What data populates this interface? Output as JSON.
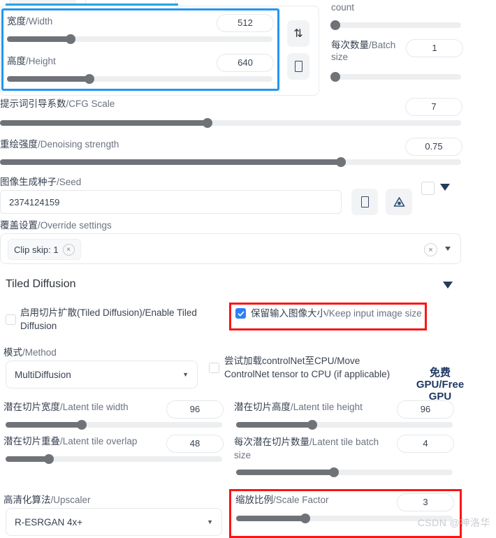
{
  "size_panel": {
    "width": {
      "label_cn": "宽度",
      "label_en": "Width",
      "value": "512",
      "slider_pct": 24
    },
    "height": {
      "label_cn": "高度",
      "label_en": "Height",
      "value": "640",
      "slider_pct": 31
    },
    "swap_icon": "swap-vertical-icon",
    "ratio_icon": "aspect-ratio-icon"
  },
  "batch": {
    "count_label_tail": "count",
    "count_slider_pct": 3,
    "size_label_cn": "每次数量",
    "size_label_en": "Batch size",
    "size_value": "1",
    "size_slider_pct": 3
  },
  "cfg": {
    "label_cn": "提示词引导系数",
    "label_en": "CFG Scale",
    "value": "7",
    "slider_pct": 45
  },
  "denoise": {
    "label_cn": "重绘强度",
    "label_en": "Denoising strength",
    "value": "0.75",
    "slider_pct": 74
  },
  "seed": {
    "label_cn": "图像生成种子",
    "label_en": "Seed",
    "value": "2374124159",
    "dice_icon": "dice-icon",
    "recycle_icon": "recycle-icon",
    "extra_checkbox": "seed-extra-checkbox",
    "expand_icon": "chevron-down-icon"
  },
  "override": {
    "label_cn": "覆盖设置",
    "label_en": "Override settings",
    "tags": [
      {
        "text": "Clip skip: 1",
        "remove": "×"
      }
    ],
    "clear": "×",
    "caret": "▾"
  },
  "tiled_diffusion": {
    "title": "Tiled Diffusion",
    "collapse_icon": "triangle-down-icon",
    "enable": {
      "label": "启用切片扩散(Tiled Diffusion)/Enable Tiled Diffusion",
      "checked": false
    },
    "keep_input_size": {
      "label_cn": "保留输入图像大小",
      "label_en": "Keep input image size",
      "checked": true,
      "highlight_color": "#fa1414"
    },
    "method": {
      "label_cn": "模式",
      "label_en": "Method",
      "value": "MultiDiffusion",
      "caret": "▾"
    },
    "move_controlnet": {
      "line1": "尝试加载controlNet至CPU/Move",
      "line2": "ControlNet tensor to CPU (if applicable)",
      "checked": false
    },
    "free_gpu": {
      "line1": "免费",
      "line2": "GPU/Free",
      "line3": "GPU"
    },
    "latent_tile_width": {
      "label_cn": "潜在切片宽度",
      "label_en": "Latent tile width",
      "value": "96",
      "slider_pct": 35
    },
    "latent_tile_height": {
      "label_cn": "潜在切片高度",
      "label_en": "Latent tile height",
      "value": "96",
      "slider_pct": 35
    },
    "latent_tile_overlap": {
      "label_cn": "潜在切片重叠",
      "label_en": "Latent tile overlap",
      "value": "48",
      "slider_pct": 20
    },
    "latent_tile_batch_size": {
      "label_cn": "每次潜在切片数量",
      "label_en": "Latent tile batch size",
      "value": "4",
      "slider_pct": 45
    },
    "upscaler": {
      "label_cn": "高清化算法",
      "label_en": "Upscaler",
      "value": "R-ESRGAN 4x+",
      "caret": "▾"
    },
    "scale_factor": {
      "label_cn": "缩放比例",
      "label_en": "Scale Factor",
      "value": "3",
      "slider_pct": 32,
      "highlight_color": "#fa1414"
    }
  },
  "watermark": "CSDN @神洛华"
}
